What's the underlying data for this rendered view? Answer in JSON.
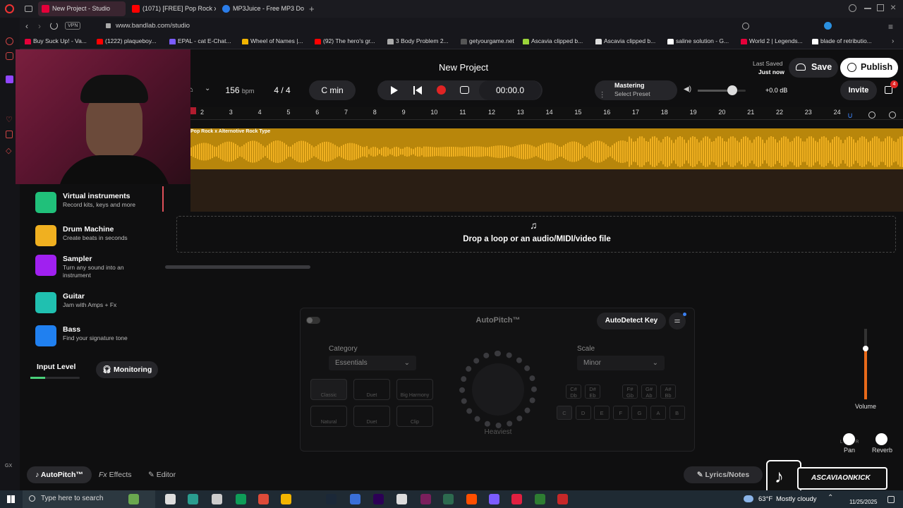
{
  "tabs": [
    {
      "label": "New Project - Studio",
      "active": true,
      "icon_color": "#e6003a"
    },
    {
      "label": "(1071) [FREE] Pop Rock x",
      "active": false,
      "icon_color": "#ff0000"
    },
    {
      "label": "MP3Juice - Free MP3 Do",
      "active": false,
      "icon_color": "#2b7de9"
    }
  ],
  "address": {
    "vpn": "VPN",
    "url": "www.bandlab.com/studio"
  },
  "bookmarks": [
    {
      "label": "Buy Suck Up! - Va...",
      "color": "#e6003a"
    },
    {
      "label": "(1222) plaqueboy...",
      "color": "#ff0000"
    },
    {
      "label": "EPAL - cat E-Chat...",
      "color": "#7b5cff"
    },
    {
      "label": "Wheel of Names |...",
      "color": "#f2b400"
    },
    {
      "label": "(92) The hero's gr...",
      "color": "#ff0000"
    },
    {
      "label": "3 Body Problem 2...",
      "color": "#aaaaaa"
    },
    {
      "label": "getyourgame.net",
      "color": "#555555"
    },
    {
      "label": "Ascavia clipped b...",
      "color": "#9bd43a"
    },
    {
      "label": "Ascavia clipped b...",
      "color": "#dddddd"
    },
    {
      "label": "saline solution - G...",
      "color": "#ffffff"
    },
    {
      "label": "World 2 | Legends...",
      "color": "#e6003a"
    },
    {
      "label": "blade of retributio...",
      "color": "#ffffff"
    }
  ],
  "studio": {
    "project_title": "New Project",
    "last_saved_label": "Last Saved",
    "last_saved_value": "Just now",
    "save_label": "Save",
    "publish_label": "Publish",
    "invite_label": "Invite",
    "notification_count": "4",
    "bpm_value": "156",
    "bpm_unit": "bpm",
    "time_sig": "4 / 4",
    "key": "C min",
    "time_display": "00:00.0",
    "mastering_label": "Mastering",
    "mastering_preset": "Select Preset",
    "volume_db": "+0.0 dB",
    "master_volume": 0.72
  },
  "ruler": {
    "ticks": [
      "2",
      "3",
      "4",
      "5",
      "6",
      "7",
      "8",
      "9",
      "10",
      "11",
      "12",
      "13",
      "14",
      "15",
      "16",
      "17",
      "18",
      "19",
      "20",
      "21",
      "22",
      "23",
      "24"
    ]
  },
  "track": {
    "name": "Pop Rock x Alternotive Rock Type",
    "color": "#f0b020"
  },
  "drop_zone": {
    "label": "Drop a loop or an audio/MIDI/video file"
  },
  "instruments": [
    {
      "title": "Virtual instruments",
      "subtitle": "Record kits, keys and more",
      "color": "#20c07a"
    },
    {
      "title": "Drum Machine",
      "subtitle": "Create beats in seconds",
      "color": "#f0b020"
    },
    {
      "title": "Sampler",
      "subtitle": "Turn any sound into an instrument",
      "color": "#a020f0"
    },
    {
      "title": "Guitar",
      "subtitle": "Jam with Amps + Fx",
      "color": "#20c0b0"
    },
    {
      "title": "Bass",
      "subtitle": "Find your signature tone",
      "color": "#2080f0"
    }
  ],
  "input": {
    "label": "Input Level",
    "monitoring_label": "Monitoring",
    "level": 0.3
  },
  "autopitch": {
    "title": "AutoPitch™",
    "autodetect_label": "AutoDetect Key",
    "category_label": "Category",
    "category_value": "Essentials",
    "scale_label": "Scale",
    "scale_value": "Minor",
    "knob_label": "Heaviest",
    "presets": [
      "Classic",
      "Duet",
      "Big Harmony",
      "Natural",
      "Duet",
      "Clip"
    ],
    "sharp_keys": [
      "C#\nDb",
      "D#\nEb",
      "F#\nGb",
      "G#\nAb",
      "A#\nBb"
    ],
    "keys": [
      "C",
      "D",
      "E",
      "F",
      "G",
      "A",
      "B"
    ]
  },
  "mixer": {
    "volume_label": "Volume",
    "pan_label": "Pan",
    "reverb_label": "Reverb",
    "pan_l": "L",
    "pan_r": "R"
  },
  "bottom_tabs": {
    "autopitch": "AutoPitch™",
    "effects": "Effects",
    "editor": "Editor",
    "lyrics": "Lyrics/Notes"
  },
  "tiktok": {
    "handle": "ASCAVIAONKICK"
  },
  "taskbar": {
    "search_placeholder": "Type here to search",
    "weather_temp": "63°F",
    "weather_desc": "Mostly cloudy",
    "clock_date": "11/25/2025"
  }
}
